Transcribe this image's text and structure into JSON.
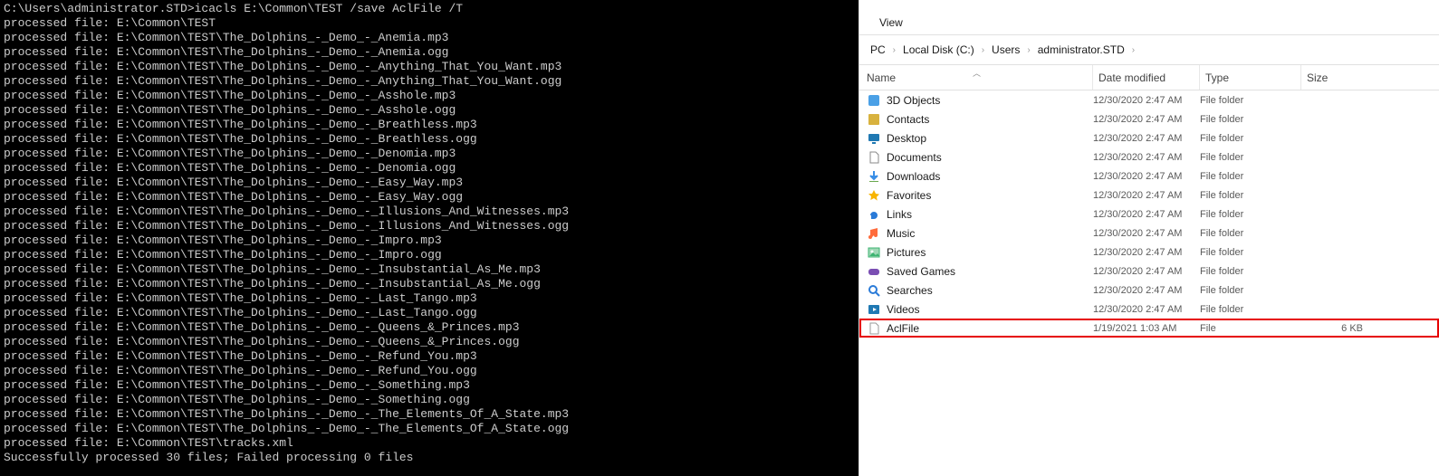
{
  "terminal": {
    "prompt": "C:\\Users\\administrator.STD>",
    "command": "icacls E:\\Common\\TEST /save AclFile /T",
    "lines": [
      "processed file: E:\\Common\\TEST",
      "processed file: E:\\Common\\TEST\\The_Dolphins_-_Demo_-_Anemia.mp3",
      "processed file: E:\\Common\\TEST\\The_Dolphins_-_Demo_-_Anemia.ogg",
      "processed file: E:\\Common\\TEST\\The_Dolphins_-_Demo_-_Anything_That_You_Want.mp3",
      "processed file: E:\\Common\\TEST\\The_Dolphins_-_Demo_-_Anything_That_You_Want.ogg",
      "processed file: E:\\Common\\TEST\\The_Dolphins_-_Demo_-_Asshole.mp3",
      "processed file: E:\\Common\\TEST\\The_Dolphins_-_Demo_-_Asshole.ogg",
      "processed file: E:\\Common\\TEST\\The_Dolphins_-_Demo_-_Breathless.mp3",
      "processed file: E:\\Common\\TEST\\The_Dolphins_-_Demo_-_Breathless.ogg",
      "processed file: E:\\Common\\TEST\\The_Dolphins_-_Demo_-_Denomia.mp3",
      "processed file: E:\\Common\\TEST\\The_Dolphins_-_Demo_-_Denomia.ogg",
      "processed file: E:\\Common\\TEST\\The_Dolphins_-_Demo_-_Easy_Way.mp3",
      "processed file: E:\\Common\\TEST\\The_Dolphins_-_Demo_-_Easy_Way.ogg",
      "processed file: E:\\Common\\TEST\\The_Dolphins_-_Demo_-_Illusions_And_Witnesses.mp3",
      "processed file: E:\\Common\\TEST\\The_Dolphins_-_Demo_-_Illusions_And_Witnesses.ogg",
      "processed file: E:\\Common\\TEST\\The_Dolphins_-_Demo_-_Impro.mp3",
      "processed file: E:\\Common\\TEST\\The_Dolphins_-_Demo_-_Impro.ogg",
      "processed file: E:\\Common\\TEST\\The_Dolphins_-_Demo_-_Insubstantial_As_Me.mp3",
      "processed file: E:\\Common\\TEST\\The_Dolphins_-_Demo_-_Insubstantial_As_Me.ogg",
      "processed file: E:\\Common\\TEST\\The_Dolphins_-_Demo_-_Last_Tango.mp3",
      "processed file: E:\\Common\\TEST\\The_Dolphins_-_Demo_-_Last_Tango.ogg",
      "processed file: E:\\Common\\TEST\\The_Dolphins_-_Demo_-_Queens_&_Princes.mp3",
      "processed file: E:\\Common\\TEST\\The_Dolphins_-_Demo_-_Queens_&_Princes.ogg",
      "processed file: E:\\Common\\TEST\\The_Dolphins_-_Demo_-_Refund_You.mp3",
      "processed file: E:\\Common\\TEST\\The_Dolphins_-_Demo_-_Refund_You.ogg",
      "processed file: E:\\Common\\TEST\\The_Dolphins_-_Demo_-_Something.mp3",
      "processed file: E:\\Common\\TEST\\The_Dolphins_-_Demo_-_Something.ogg",
      "processed file: E:\\Common\\TEST\\The_Dolphins_-_Demo_-_The_Elements_Of_A_State.mp3",
      "processed file: E:\\Common\\TEST\\The_Dolphins_-_Demo_-_The_Elements_Of_A_State.ogg",
      "processed file: E:\\Common\\TEST\\tracks.xml",
      "Successfully processed 30 files; Failed processing 0 files"
    ]
  },
  "explorer": {
    "ribbon": {
      "view": "View"
    },
    "breadcrumb": [
      "PC",
      "Local Disk (C:)",
      "Users",
      "administrator.STD"
    ],
    "columns": {
      "name": "Name",
      "date": "Date modified",
      "type": "Type",
      "size": "Size"
    },
    "rows": [
      {
        "icon": "3d",
        "name": "3D Objects",
        "date": "12/30/2020 2:47 AM",
        "type": "File folder",
        "size": ""
      },
      {
        "icon": "contacts",
        "name": "Contacts",
        "date": "12/30/2020 2:47 AM",
        "type": "File folder",
        "size": ""
      },
      {
        "icon": "desktop",
        "name": "Desktop",
        "date": "12/30/2020 2:47 AM",
        "type": "File folder",
        "size": ""
      },
      {
        "icon": "doc",
        "name": "Documents",
        "date": "12/30/2020 2:47 AM",
        "type": "File folder",
        "size": ""
      },
      {
        "icon": "down",
        "name": "Downloads",
        "date": "12/30/2020 2:47 AM",
        "type": "File folder",
        "size": ""
      },
      {
        "icon": "star",
        "name": "Favorites",
        "date": "12/30/2020 2:47 AM",
        "type": "File folder",
        "size": ""
      },
      {
        "icon": "link",
        "name": "Links",
        "date": "12/30/2020 2:47 AM",
        "type": "File folder",
        "size": ""
      },
      {
        "icon": "music",
        "name": "Music",
        "date": "12/30/2020 2:47 AM",
        "type": "File folder",
        "size": ""
      },
      {
        "icon": "pic",
        "name": "Pictures",
        "date": "12/30/2020 2:47 AM",
        "type": "File folder",
        "size": ""
      },
      {
        "icon": "game",
        "name": "Saved Games",
        "date": "12/30/2020 2:47 AM",
        "type": "File folder",
        "size": ""
      },
      {
        "icon": "search",
        "name": "Searches",
        "date": "12/30/2020 2:47 AM",
        "type": "File folder",
        "size": ""
      },
      {
        "icon": "video",
        "name": "Videos",
        "date": "12/30/2020 2:47 AM",
        "type": "File folder",
        "size": ""
      },
      {
        "icon": "file",
        "name": "AclFile",
        "date": "1/19/2021 1:03 AM",
        "type": "File",
        "size": "6 KB",
        "highlight": true
      }
    ]
  }
}
